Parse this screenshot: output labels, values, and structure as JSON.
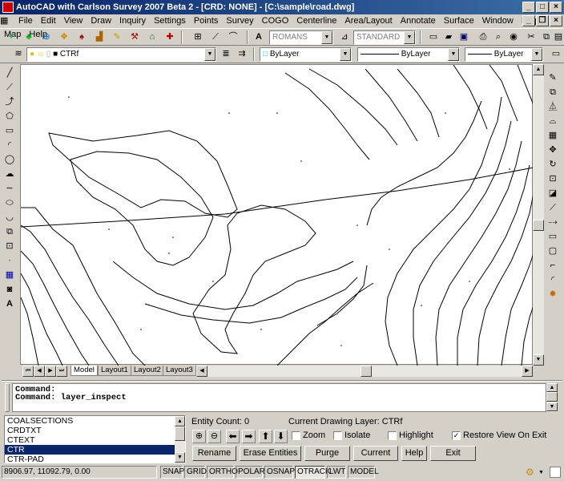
{
  "window": {
    "title": "AutoCAD with Carlson Survey 2007 Beta 2 - [CRD: NONE] - [C:\\sample\\road.dwg]"
  },
  "menu": [
    "File",
    "Edit",
    "View",
    "Draw",
    "Inquiry",
    "Settings",
    "Points",
    "Survey",
    "COGO",
    "Centerline",
    "Area/Layout",
    "Annotate",
    "Surface",
    "Window",
    "Help",
    "Map",
    "Help"
  ],
  "toolbar": {
    "text_style": "ROMANS",
    "dim_style": "STANDARD",
    "layer": "CTRf",
    "color": "ByLayer",
    "linetype": "ByLayer",
    "lineweight": "ByLayer"
  },
  "tabs": [
    "Model",
    "Layout1",
    "Layout2",
    "Layout3"
  ],
  "command": {
    "line1": "Command:",
    "line2": "Command:  layer_inspect"
  },
  "layers": [
    "COALSECTIONS",
    "CRDTXT",
    "CTEXT",
    "CTR",
    "CTR-PAD"
  ],
  "selected_layer": "CTR",
  "inspector": {
    "entity_count": "Entity Count: 0",
    "current_layer": "Current Drawing Layer: CTRf",
    "zoom": "Zoom",
    "isolate": "Isolate",
    "highlight": "Highlight",
    "restore": "Restore View On Exit",
    "rename": "Rename",
    "erase": "Erase Entities",
    "purge": "Purge",
    "current": "Current",
    "help": "Help",
    "exit": "Exit"
  },
  "status": {
    "coords": "8906.97, 11092.79, 0.00",
    "snap": "SNAP",
    "grid": "GRID",
    "ortho": "ORTHO",
    "polar": "POLAR",
    "osnap": "OSNAP",
    "otrack": "OTRACK",
    "lwt": "LWT",
    "model": "MODEL"
  }
}
